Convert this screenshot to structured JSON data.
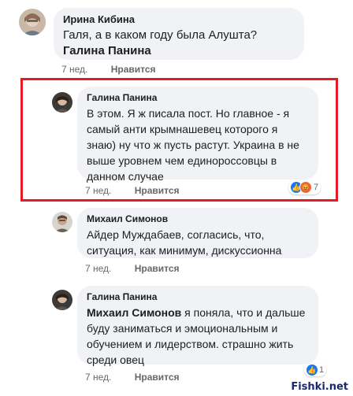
{
  "comments": [
    {
      "author": "Ирина Кибина",
      "text": "Галя, а в каком году была Алушта?",
      "mention": "Галина Панина",
      "time": "7 нед.",
      "like": "Нравится"
    },
    {
      "author": "Галина Панина",
      "text": "В этом. Я ж писала пост. Но главное - я самый анти крымнашевец которого я знаю) ну что ж пусть растут. Украина в не выше уровнем чем единороссовцы в данном случае",
      "time": "7 нед.",
      "like": "Нравится",
      "reactions_count": "7"
    },
    {
      "author": "Михаил Симонов",
      "text": "Айдер Муждабаев, согласись, что, ситуация, как минимум, дискуссионна",
      "time": "7 нед.",
      "like": "Нравится"
    },
    {
      "author": "Галина Панина",
      "mention": "Михаил Симонов",
      "text": " я поняла, что и дальше буду заниматься и эмоциональным и обучением и лидерством. страшно жить среди овец",
      "time": "7 нед.",
      "like": "Нравится",
      "reactions_count": "1"
    }
  ],
  "watermark": "Fishki.net",
  "colors": {
    "highlight": "#e41b24",
    "bubble": "#f0f2f5",
    "like": "#1877f2"
  }
}
